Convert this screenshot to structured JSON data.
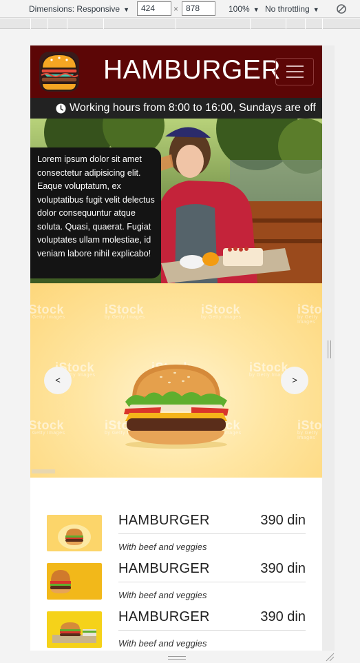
{
  "devtools": {
    "device_label": "Dimensions: Responsive",
    "width_value": "424",
    "times": "×",
    "height_value": "878",
    "zoom_label": "100%",
    "throttle_label": "No throttling",
    "icons": [
      "dropdown-caret-icon",
      "rotate-icon",
      "resize-grip-icon"
    ]
  },
  "header": {
    "brand": "HAMBURGER",
    "logo_icon": "burger-logo-icon",
    "menu_icon": "hamburger-menu-icon",
    "bg_color": "#5c0606"
  },
  "hours": {
    "icon": "clock-icon",
    "text": "Working hours from 8:00 to 16:00, Sundays are off"
  },
  "hero": {
    "text": "Lorem ipsum dolor sit amet consectetur adipisicing elit. Eaque voluptatum, ex voluptatibus fugit velit delectus dolor consequuntur atque soluta. Quasi, quaerat. Fugiat voluptates ullam molestiae, id veniam labore nihil explicabo!"
  },
  "carousel": {
    "prev_label": "<",
    "next_label": ">",
    "watermark": "iStock",
    "watermark_sub": "by Getty Images"
  },
  "menu": {
    "items": [
      {
        "name": "HAMBURGER",
        "price": "390 din",
        "description": "With beef and veggies"
      },
      {
        "name": "HAMBURGER",
        "price": "390 din",
        "description": "With beef and veggies"
      },
      {
        "name": "HAMBURGER",
        "price": "390 din",
        "description": "With beef and veggies"
      }
    ]
  }
}
